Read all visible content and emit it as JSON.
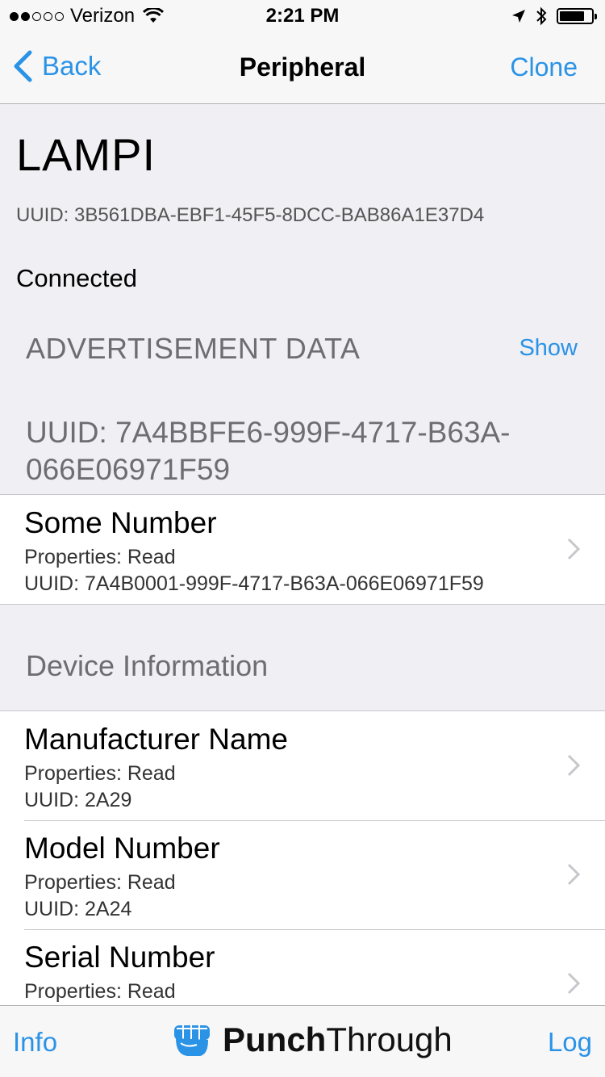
{
  "status_bar": {
    "carrier": "Verizon",
    "time": "2:21 PM",
    "signal_dots_filled": 2,
    "signal_dots_total": 5,
    "battery_level": 0.8,
    "icons": [
      "wifi-icon",
      "location-icon",
      "bluetooth-icon",
      "battery-icon"
    ]
  },
  "nav": {
    "back_label": "Back",
    "title": "Peripheral",
    "clone_label": "Clone"
  },
  "device": {
    "name": "LAMPI",
    "uuid": "UUID: 3B561DBA-EBF1-45F5-8DCC-BAB86A1E37D4",
    "status": "Connected"
  },
  "advertisement": {
    "label": "ADVERTISEMENT DATA",
    "show_label": "Show"
  },
  "service": {
    "uuid": "UUID: 7A4BBFE6-999F-4717-B63A-066E06971F59",
    "characteristics": [
      {
        "name": "Some Number",
        "properties": "Properties: Read",
        "uuid": "UUID: 7A4B0001-999F-4717-B63A-066E06971F59"
      }
    ]
  },
  "device_information": {
    "header": "Device Information",
    "characteristics": [
      {
        "name": "Manufacturer Name",
        "properties": "Properties: Read",
        "uuid": "UUID: 2A29"
      },
      {
        "name": "Model Number",
        "properties": "Properties: Read",
        "uuid": "UUID: 2A24"
      },
      {
        "name": "Serial Number",
        "properties": "Properties: Read",
        "uuid": ""
      }
    ]
  },
  "bottom_bar": {
    "info_label": "Info",
    "log_label": "Log",
    "logo_bold": "Punch",
    "logo_regular": "Through"
  },
  "colors": {
    "accent": "#2b93e6",
    "background": "#efeff4",
    "secondary_text": "#6d6d72"
  }
}
